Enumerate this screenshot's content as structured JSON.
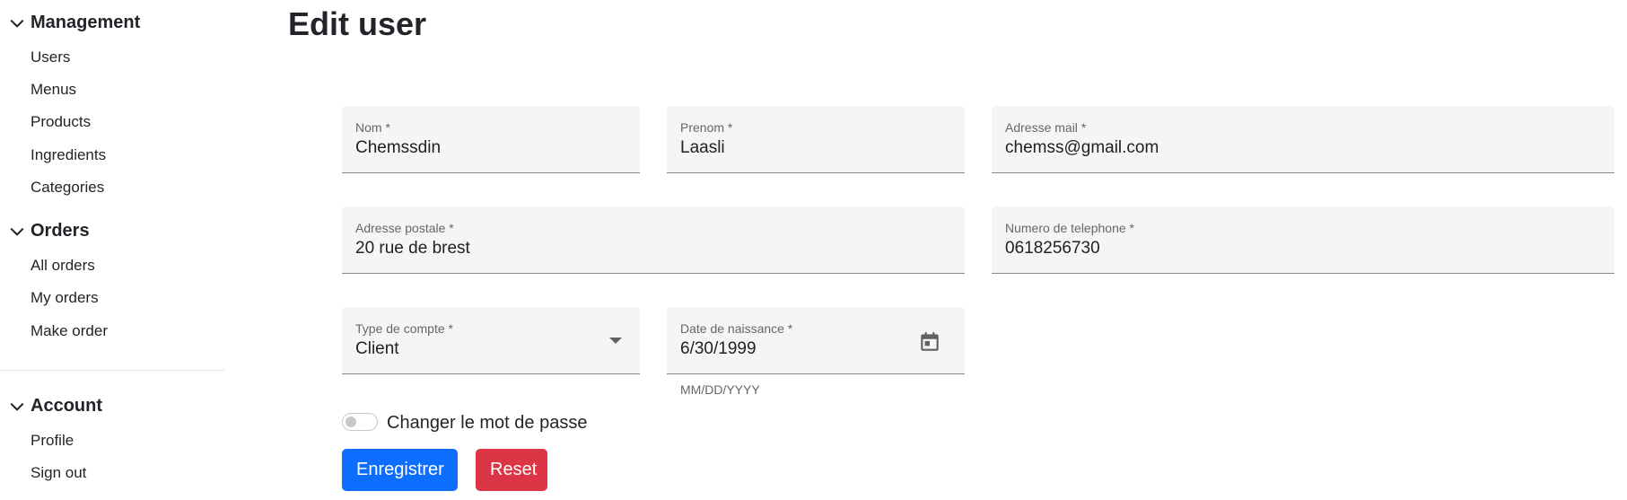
{
  "sidebar": {
    "sections": [
      {
        "title": "Management",
        "items": [
          "Users",
          "Menus",
          "Products",
          "Ingredients",
          "Categories"
        ]
      },
      {
        "title": "Orders",
        "items": [
          "All orders",
          "My orders",
          "Make order"
        ]
      },
      {
        "title": "Account",
        "items": [
          "Profile",
          "Sign out"
        ]
      }
    ]
  },
  "page": {
    "title": "Edit user"
  },
  "form": {
    "nom": {
      "label": "Nom *",
      "value": "Chemssdin"
    },
    "prenom": {
      "label": "Prenom *",
      "value": "Laasli"
    },
    "email": {
      "label": "Adresse mail *",
      "value": "chemss@gmail.com"
    },
    "adresse": {
      "label": "Adresse postale *",
      "value": "20 rue de brest"
    },
    "telephone": {
      "label": "Numero de telephone *",
      "value": "0618256730"
    },
    "type_compte": {
      "label": "Type de compte *",
      "value": "Client"
    },
    "date_naissance": {
      "label": "Date de naissance *",
      "value": "6/30/1999",
      "hint": "MM/DD/YYYY"
    },
    "toggle_label": "Changer le mot de passe",
    "save_label": "Enregistrer",
    "reset_label": "Reset"
  },
  "icons": {
    "section_toggle": "chevron-down-icon",
    "calendar": "calendar-icon",
    "dropdown": "dropdown-arrow-icon"
  },
  "colors": {
    "primary": "#0d6efd",
    "danger": "#dc3545",
    "field_bg": "#f5f5f5"
  }
}
